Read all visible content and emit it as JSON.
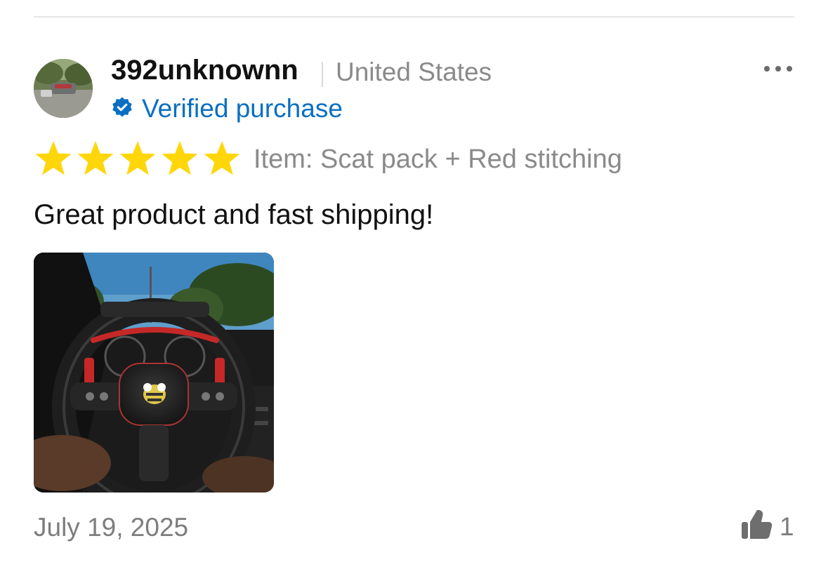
{
  "review": {
    "username": "392unknownn",
    "country": "United States",
    "verified_label": "Verified purchase",
    "rating": 5,
    "rating_max": 5,
    "item_variant": "Item: Scat pack + Red stitching",
    "text": "Great product and fast shipping!",
    "date": "July 19, 2025",
    "helpful_count": "1"
  },
  "icons": {
    "verified": "verified-badge-icon",
    "more": "more-options-icon",
    "star": "star-icon",
    "helpful": "thumbs-up-icon"
  },
  "colors": {
    "star": "#FFD60A",
    "verified": "#0A6FC2",
    "muted_text": "#8A8A8A",
    "divider": "#E6E6E6"
  }
}
